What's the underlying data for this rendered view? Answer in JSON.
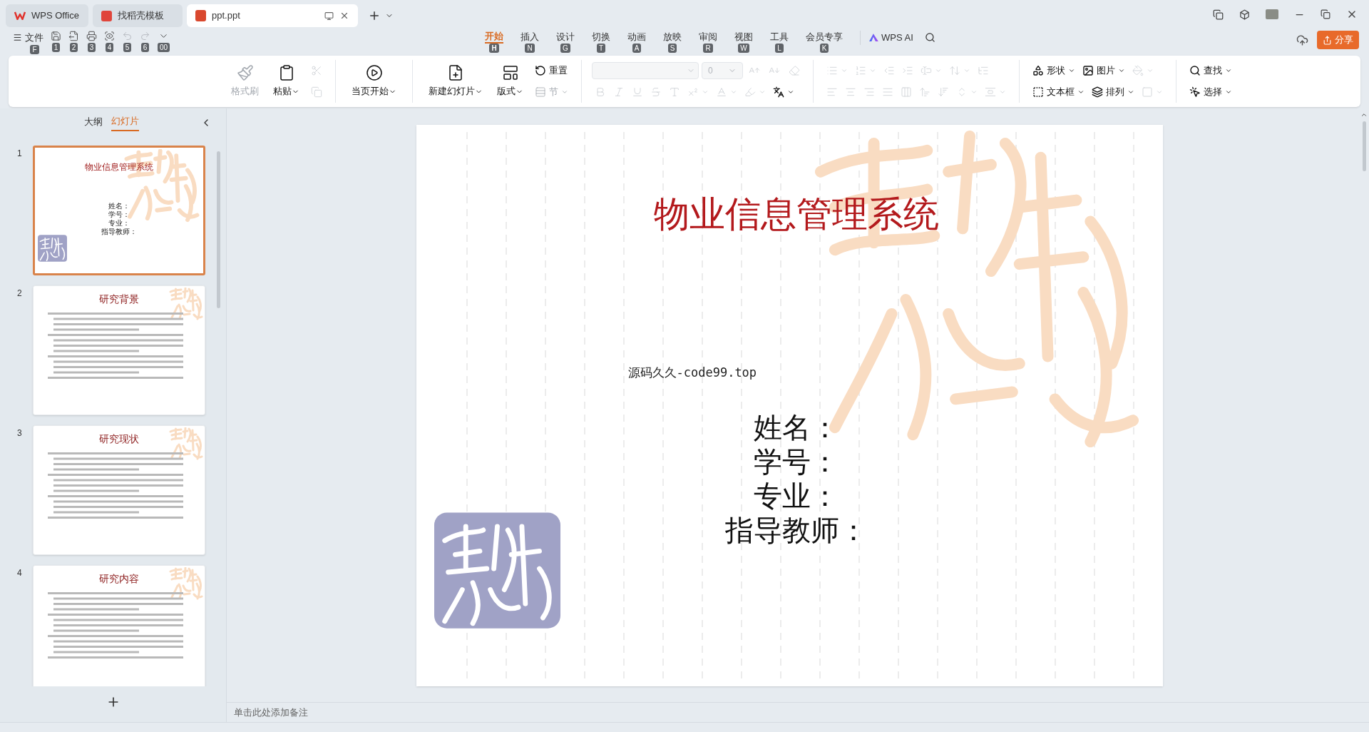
{
  "tabs": [
    {
      "label": "WPS Office",
      "kind": "home",
      "selected": false
    },
    {
      "label": "找稻壳模板",
      "kind": "template",
      "selected": false
    },
    {
      "label": "ppt.ppt",
      "kind": "doc",
      "selected": true
    }
  ],
  "file_menu": {
    "label": "文件",
    "key": "F"
  },
  "quick_tools": [
    {
      "kind": "save",
      "key": "1",
      "disabled": false
    },
    {
      "kind": "export",
      "key": "2",
      "disabled": false
    },
    {
      "kind": "print",
      "key": "3",
      "disabled": false
    },
    {
      "kind": "preview",
      "key": "4",
      "disabled": false
    },
    {
      "kind": "undo",
      "key": "5",
      "disabled": true
    },
    {
      "kind": "redo",
      "key": "6",
      "disabled": true
    },
    {
      "kind": "more",
      "key": "00",
      "disabled": false
    }
  ],
  "menu_tabs": [
    {
      "label": "开始",
      "key": "H",
      "selected": true
    },
    {
      "label": "插入",
      "key": "N",
      "selected": false
    },
    {
      "label": "设计",
      "key": "G",
      "selected": false
    },
    {
      "label": "切换",
      "key": "T",
      "selected": false
    },
    {
      "label": "动画",
      "key": "A",
      "selected": false
    },
    {
      "label": "放映",
      "key": "S",
      "selected": false
    },
    {
      "label": "审阅",
      "key": "R",
      "selected": false
    },
    {
      "label": "视图",
      "key": "W",
      "selected": false
    },
    {
      "label": "工具",
      "key": "L",
      "selected": false
    },
    {
      "label": "会员专享",
      "key": "K",
      "selected": false
    }
  ],
  "wps_ai": {
    "label": "WPS AI"
  },
  "share_button": {
    "label": "分享"
  },
  "ribbon": [
    {
      "large": [
        {
          "kind": "format-painter",
          "label": "格式刷",
          "disabled": true,
          "dropdown": false
        },
        {
          "kind": "paste",
          "label": "粘贴",
          "disabled": false,
          "dropdown": true
        }
      ],
      "rows": [
        [
          {
            "kind": "cut",
            "disabled": true,
            "dropdown": false
          }
        ],
        [
          {
            "kind": "copy",
            "disabled": true,
            "dropdown": false
          }
        ]
      ]
    },
    {
      "large": [
        {
          "kind": "play",
          "label": "当页开始",
          "disabled": false,
          "dropdown": true
        }
      ]
    },
    {
      "large": [
        {
          "kind": "new-slide",
          "label": "新建幻灯片",
          "disabled": false,
          "dropdown": true
        },
        {
          "kind": "layout",
          "label": "版式",
          "disabled": false,
          "dropdown": true
        }
      ],
      "rows": [
        [
          {
            "kind": "reset",
            "label": "重置",
            "disabled": false,
            "dropdown": false
          }
        ],
        [
          {
            "kind": "section",
            "label": "节",
            "disabled": true,
            "dropdown": true
          }
        ]
      ]
    },
    {
      "fields": [
        {
          "kind": "font-name",
          "disabled": true
        },
        {
          "kind": "font-size",
          "value": "0",
          "disabled": true
        }
      ],
      "rows": [
        [
          {
            "kind": "grow",
            "disabled": true,
            "dropdown": false
          },
          {
            "kind": "shrink",
            "disabled": true,
            "dropdown": false
          },
          {
            "kind": "eraser",
            "disabled": true,
            "dropdown": false
          }
        ],
        [
          {
            "kind": "bold",
            "disabled": true,
            "dropdown": false
          },
          {
            "kind": "italic",
            "disabled": true,
            "dropdown": false
          },
          {
            "kind": "underline",
            "disabled": true,
            "dropdown": false
          },
          {
            "kind": "strike",
            "disabled": true,
            "dropdown": false
          },
          {
            "kind": "shadow",
            "disabled": true,
            "dropdown": false
          },
          {
            "kind": "superscript",
            "disabled": true,
            "dropdown": true
          },
          {
            "kind": "font-color",
            "disabled": true,
            "dropdown": true
          },
          {
            "kind": "highlight",
            "disabled": true,
            "dropdown": true
          },
          {
            "kind": "phonetic",
            "disabled": false,
            "dropdown": true
          }
        ]
      ]
    },
    {
      "rows": [
        [
          {
            "kind": "bullets",
            "disabled": true,
            "dropdown": true
          },
          {
            "kind": "numbering",
            "disabled": true,
            "dropdown": true
          },
          {
            "kind": "outdent",
            "disabled": true,
            "dropdown": false
          },
          {
            "kind": "indent",
            "disabled": true,
            "dropdown": false
          },
          {
            "kind": "text-direction",
            "disabled": true,
            "dropdown": true
          },
          {
            "kind": "sort",
            "disabled": true,
            "dropdown": true
          },
          {
            "kind": "convert",
            "disabled": true,
            "dropdown": false
          }
        ],
        [
          {
            "kind": "align-left",
            "disabled": true,
            "dropdown": false
          },
          {
            "kind": "align-center",
            "disabled": true,
            "dropdown": false
          },
          {
            "kind": "align-right",
            "disabled": true,
            "dropdown": false
          },
          {
            "kind": "justify",
            "disabled": true,
            "dropdown": false
          },
          {
            "kind": "distribute",
            "disabled": true,
            "dropdown": false
          },
          {
            "kind": "para-up",
            "disabled": true,
            "dropdown": false
          },
          {
            "kind": "para-down",
            "disabled": true,
            "dropdown": false
          },
          {
            "kind": "line-spacing",
            "disabled": true,
            "dropdown": true
          },
          {
            "kind": "valign",
            "disabled": true,
            "dropdown": true
          }
        ]
      ]
    },
    {
      "rows": [
        [
          {
            "kind": "shapes",
            "label": "形状",
            "disabled": false,
            "dropdown": true
          },
          {
            "kind": "image",
            "label": "图片",
            "disabled": false,
            "dropdown": true
          },
          {
            "kind": "fill",
            "disabled": true,
            "dropdown": true
          }
        ],
        [
          {
            "kind": "textbox",
            "label": "文本框",
            "disabled": false,
            "dropdown": true
          },
          {
            "kind": "arrange",
            "label": "排列",
            "disabled": false,
            "dropdown": true
          },
          {
            "kind": "outline",
            "disabled": true,
            "dropdown": true
          }
        ]
      ]
    },
    {
      "rows": [
        [
          {
            "kind": "find",
            "label": "查找",
            "disabled": false,
            "dropdown": true
          }
        ],
        [
          {
            "kind": "select",
            "label": "选择",
            "disabled": false,
            "dropdown": true
          }
        ]
      ]
    }
  ],
  "panel_tabs": [
    {
      "label": "大纲",
      "selected": false
    },
    {
      "label": "幻灯片",
      "selected": true
    }
  ],
  "thumbnails": [
    {
      "number": "1",
      "kind": "cover",
      "title": "物业信息管理系统",
      "fields": [
        "姓名：",
        "学号：",
        "专业：",
        "指导教师："
      ],
      "selected": true
    },
    {
      "number": "2",
      "kind": "content",
      "title": "研究背景",
      "selected": false
    },
    {
      "number": "3",
      "kind": "content",
      "title": "研究现状",
      "selected": false
    },
    {
      "number": "4",
      "kind": "content",
      "title": "研究内容",
      "selected": false
    }
  ],
  "slide": {
    "title": "物业信息管理系统",
    "subtitle": "源码久久-code99.top",
    "fields": [
      "姓名：",
      "学号：",
      "专业：",
      "指导教师："
    ]
  },
  "notes": {
    "placeholder": "单击此处添加备注"
  }
}
